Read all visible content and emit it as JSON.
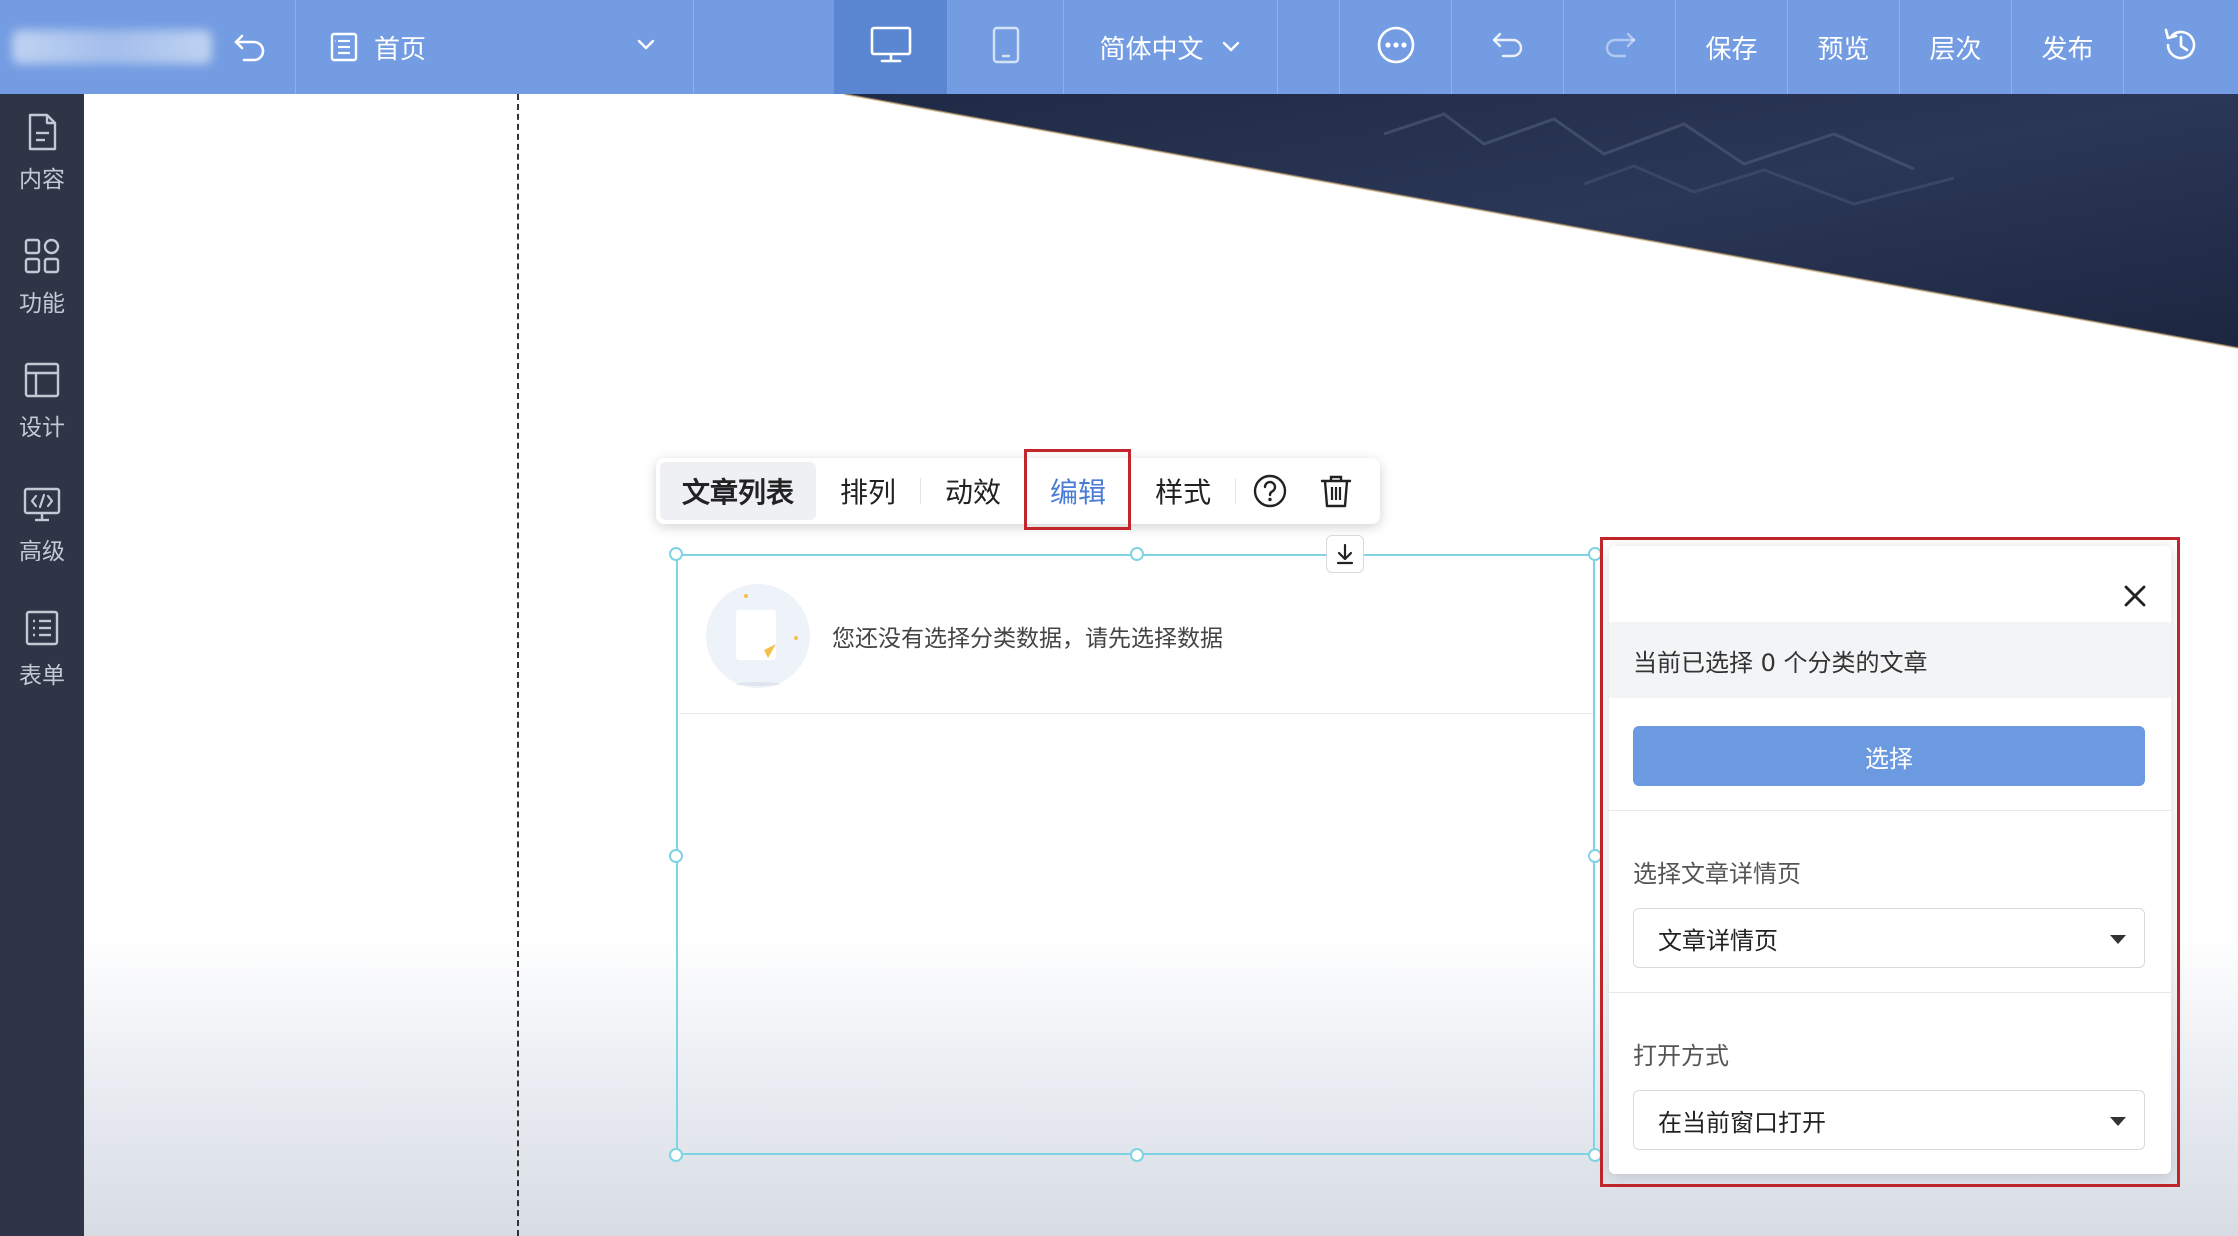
{
  "topbar": {
    "page_selector": "首页",
    "language": "简体中文",
    "actions": {
      "save": "保存",
      "preview": "预览",
      "layers": "层次",
      "publish": "发布"
    }
  },
  "sidebar": {
    "items": [
      {
        "label": "内容",
        "icon": "file-icon"
      },
      {
        "label": "功能",
        "icon": "grid-icon"
      },
      {
        "label": "设计",
        "icon": "layout-icon"
      },
      {
        "label": "高级",
        "icon": "code-monitor-icon"
      },
      {
        "label": "表单",
        "icon": "list-icon"
      }
    ]
  },
  "module_toolbar": {
    "title": "文章列表",
    "tabs": [
      "排列",
      "动效",
      "编辑",
      "样式"
    ],
    "active_tab": "编辑"
  },
  "module": {
    "empty_message": "您还没有选择分类数据，请先选择数据"
  },
  "edit_panel": {
    "status_text": "当前已选择 0 个分类的文章",
    "select_button": "选择",
    "detail_page_label": "选择文章详情页",
    "detail_page_value": "文章详情页",
    "open_mode_label": "打开方式",
    "open_mode_value": "在当前窗口打开"
  },
  "colors": {
    "topbar": "#739ce2",
    "sidebar": "#2e3546",
    "accent": "#4a7dd6",
    "highlight_box": "#c0262b",
    "selection_frame": "#7fd3e3"
  }
}
